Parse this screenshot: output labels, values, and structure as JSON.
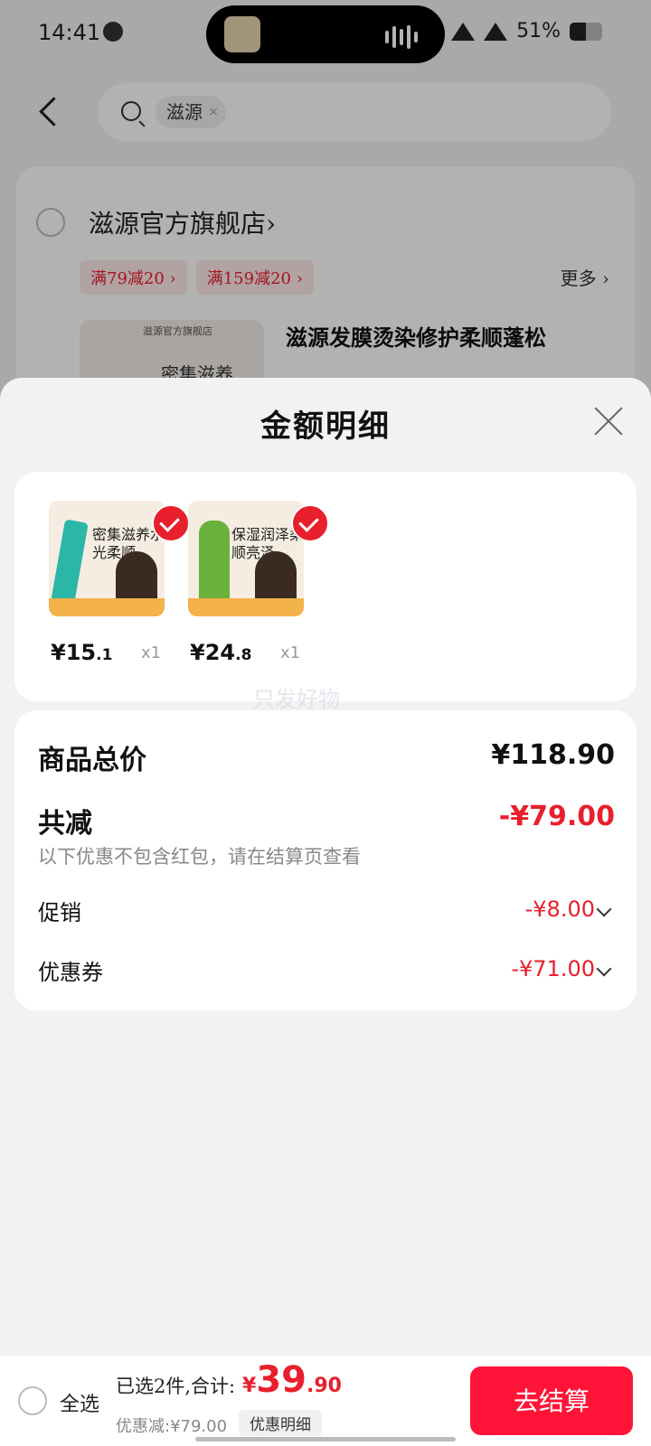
{
  "status_bar": {
    "time": "14:41",
    "battery": "51%",
    "battery_level": 0.51
  },
  "search": {
    "keyword": "滋源",
    "clear": "×"
  },
  "store": {
    "name": "滋源官方旗舰店›",
    "badges": [
      "满79减20 ›",
      "满159减20 ›"
    ],
    "more": "更多 ›",
    "product_title": "滋源发膜烫染修护柔顺蓬松",
    "product_image_header": "滋源官方旗舰店",
    "product_image_text": "密集滋养"
  },
  "sheet": {
    "title": "金额明细",
    "items": [
      {
        "price_int": "¥15",
        "price_dec": ".1",
        "qty": "x1",
        "image_text": "密集滋养水光柔顺"
      },
      {
        "price_int": "¥24",
        "price_dec": ".8",
        "qty": "x1",
        "image_text": "保湿润泽柔顺亮泽"
      }
    ],
    "watermark": "只发好物",
    "summary": {
      "total_label": "商品总价",
      "total_value": "¥118.90",
      "reduce_label": "共减",
      "reduce_value": "-¥79.00",
      "note": "以下优惠不包含红包，请在结算页查看",
      "promo_label": "促销",
      "promo_value": "-¥8.00",
      "coupon_label": "优惠券",
      "coupon_value": "-¥71.00"
    }
  },
  "bottom": {
    "select_all": "全选",
    "selected_text": "已选2件,合计:",
    "price_currency": "¥",
    "price_int": "39",
    "price_dec": ".90",
    "discount_text": "优惠减:¥79.00",
    "detail_button": "优惠明细",
    "checkout_button": "去结算"
  },
  "colors": {
    "accent": "#e81f2c",
    "checkout": "#ff1437"
  }
}
